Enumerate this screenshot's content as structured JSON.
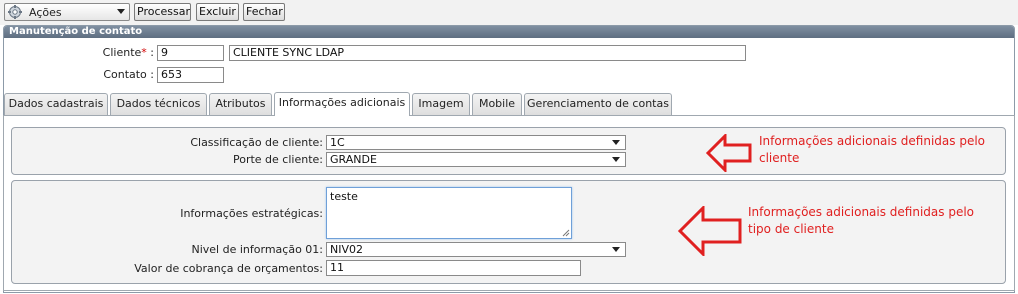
{
  "toolbar": {
    "actions_label": "Ações",
    "process_label": "Processar",
    "delete_label": "Excluir",
    "close_label": "Fechar"
  },
  "panel": {
    "title": "Manutenção de contato",
    "cliente_label": "Cliente",
    "cliente_required_mark": "*",
    "cliente_suffix": " :",
    "cliente_code": "9",
    "cliente_name": "CLIENTE SYNC LDAP",
    "contato_label": "Contato :",
    "contato_value": "653"
  },
  "tabs": [
    {
      "label": "Dados cadastrais",
      "active": false
    },
    {
      "label": "Dados técnicos",
      "active": false
    },
    {
      "label": "Atributos",
      "active": false
    },
    {
      "label": "Informações adicionais",
      "active": true
    },
    {
      "label": "Imagem",
      "active": false
    },
    {
      "label": "Mobile",
      "active": false
    },
    {
      "label": "Gerenciamento de contas",
      "active": false
    }
  ],
  "client_info": {
    "classificacao_label": "Classificação de cliente:",
    "classificacao_value": "1C",
    "porte_label": "Porte de cliente:",
    "porte_value": "GRANDE"
  },
  "type_info": {
    "estrategicas_label": "Informações estratégicas:",
    "estrategicas_value": "teste",
    "nivel_label": "Nivel de informação 01:",
    "nivel_value": "NIV02",
    "valor_label": "Valor de cobrança de orçamentos:",
    "valor_value": "11"
  },
  "annotations": {
    "client_note_line1": "Informações adicionais definidas pelo",
    "client_note_line2": "cliente",
    "type_note_line1": "Informações adicionais definidas pelo",
    "type_note_line2": "tipo de cliente",
    "arrow_color": "#e02020"
  }
}
